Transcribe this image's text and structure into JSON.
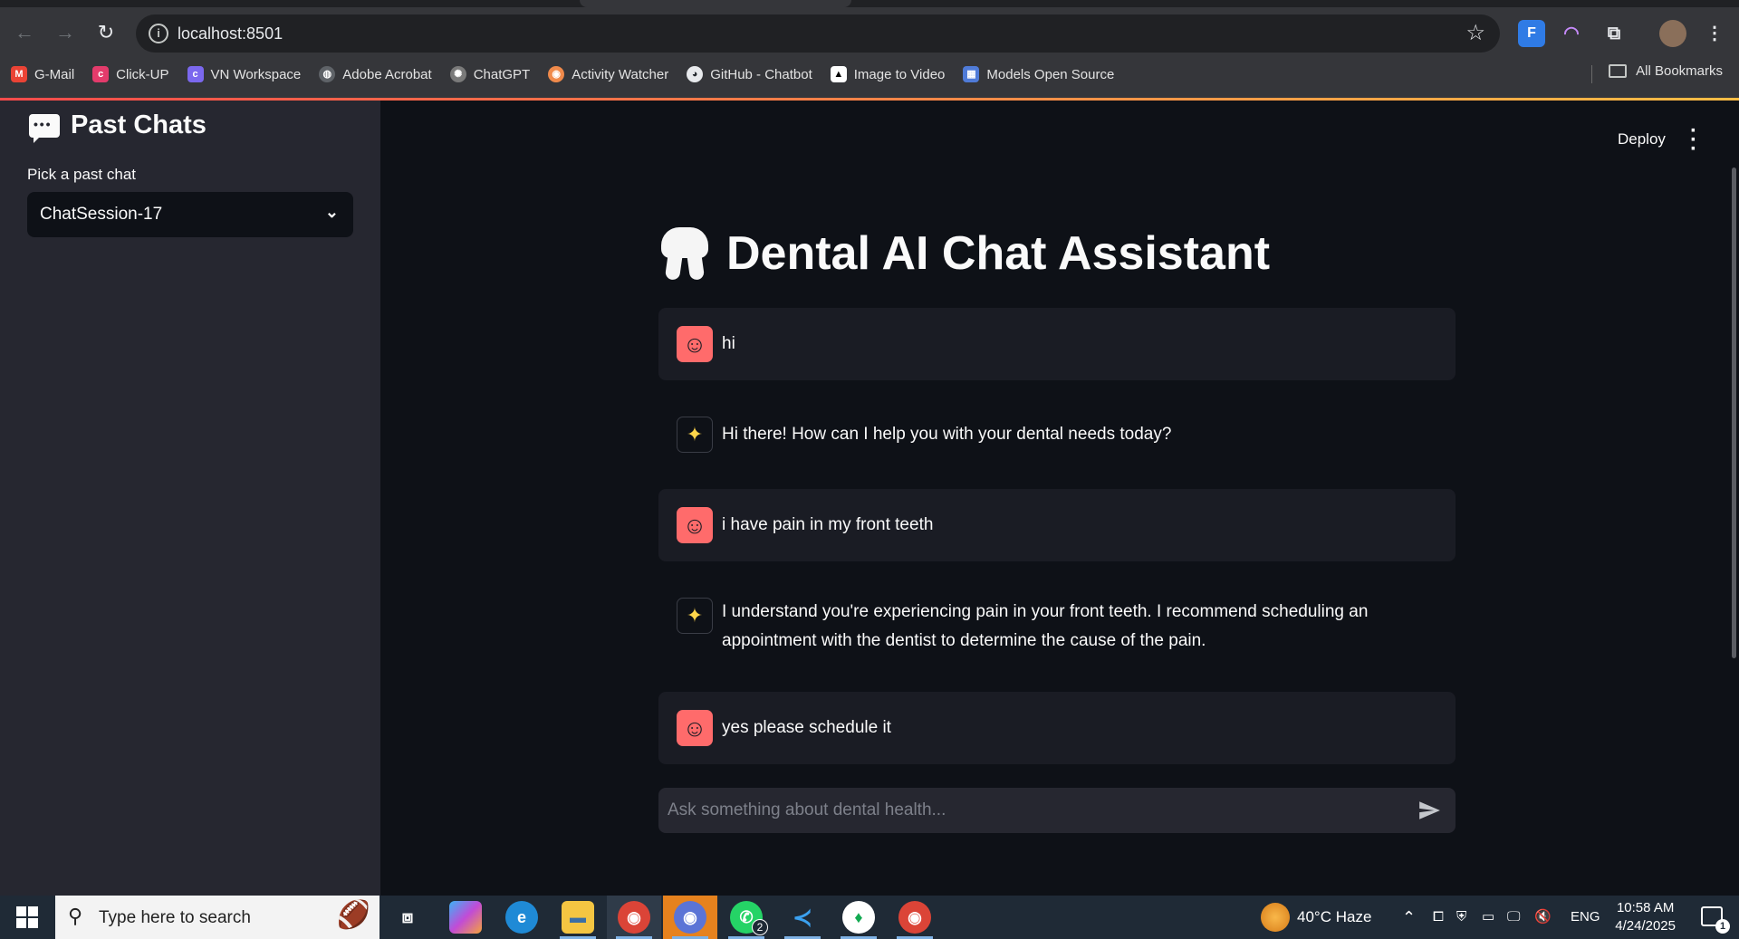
{
  "browser": {
    "url": "localhost:8501",
    "bookmarks": [
      {
        "label": "G-Mail",
        "icon": "gmail-icon",
        "color": "#ea4335"
      },
      {
        "label": "Click-UP",
        "icon": "clickup-icon",
        "color": "#e33b6b"
      },
      {
        "label": "VN Workspace",
        "icon": "clickup-icon",
        "color": "#7b68ee"
      },
      {
        "label": "Adobe Acrobat",
        "icon": "globe-icon",
        "color": "#8a8a8a"
      },
      {
        "label": "ChatGPT",
        "icon": "openai-icon",
        "color": "#7a7a7a"
      },
      {
        "label": "Activity Watcher",
        "icon": "watcher-icon",
        "color": "#f08a4b"
      },
      {
        "label": "GitHub - Chatbot",
        "icon": "github-icon",
        "color": "#24292e"
      },
      {
        "label": "Image to Video",
        "icon": "triangle-icon",
        "color": "#000000"
      },
      {
        "label": "Models Open Source",
        "icon": "models-icon",
        "color": "#4f7bd8"
      }
    ],
    "all_bookmarks_label": "All Bookmarks",
    "extensions": [
      {
        "label": "F",
        "color": "#2f7be5"
      },
      {
        "label": "◠",
        "color": "#35363a"
      }
    ]
  },
  "app": {
    "deploy_label": "Deploy",
    "sidebar": {
      "title": "Past Chats",
      "select_label": "Pick a past chat",
      "selected_chat": "ChatSession-17"
    },
    "title": "Dental AI Chat Assistant",
    "messages": [
      {
        "role": "user",
        "text": "hi"
      },
      {
        "role": "assistant",
        "text": "Hi there! How can I help you with your dental needs today?"
      },
      {
        "role": "user",
        "text": "i have pain in my front teeth"
      },
      {
        "role": "assistant",
        "text": "I understand you're experiencing pain in your front teeth. I recommend scheduling an appointment with the dentist to determine the cause of the pain."
      },
      {
        "role": "user",
        "text": "yes please schedule it"
      }
    ],
    "input_placeholder": "Ask something about dental health...",
    "accent_color": "#ff4b4b"
  },
  "taskbar": {
    "search_placeholder": "Type here to search",
    "weather": "40°C  Haze",
    "language": "ENG",
    "time": "10:58 AM",
    "date": "4/24/2025",
    "whatsapp_badge": "2",
    "notification_count": "1"
  }
}
